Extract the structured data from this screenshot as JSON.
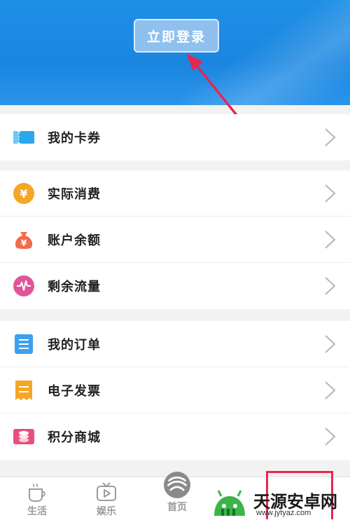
{
  "header": {
    "login_label": "立即登录"
  },
  "groups": [
    {
      "items": [
        {
          "label": "我的卡券",
          "icon": "ticket-icon",
          "color": "#2aa7ee"
        }
      ]
    },
    {
      "items": [
        {
          "label": "实际消费",
          "icon": "yen-coin-icon",
          "color": "#f5a623"
        },
        {
          "label": "账户余额",
          "icon": "money-bag-icon",
          "color": "#f26b4f"
        },
        {
          "label": "剩余流量",
          "icon": "pulse-icon",
          "color": "#e0559a"
        }
      ]
    },
    {
      "items": [
        {
          "label": "我的订单",
          "icon": "order-list-icon",
          "color": "#3aa0f0"
        },
        {
          "label": "电子发票",
          "icon": "invoice-icon",
          "color": "#f5a623"
        },
        {
          "label": "积分商城",
          "icon": "points-coins-icon",
          "color": "#e8507a"
        }
      ]
    }
  ],
  "tabbar": {
    "tabs": [
      {
        "label": "生活",
        "icon": "coffee-cup-icon"
      },
      {
        "label": "娱乐",
        "icon": "tv-play-icon"
      },
      {
        "label": "首页",
        "icon": "china-mobile-logo-icon"
      }
    ]
  },
  "watermark": {
    "text": "天源安卓网",
    "url": "www.jytyaz.com"
  },
  "colors": {
    "header_blue": "#1f8fe6",
    "annotation_red": "#e8264f"
  }
}
